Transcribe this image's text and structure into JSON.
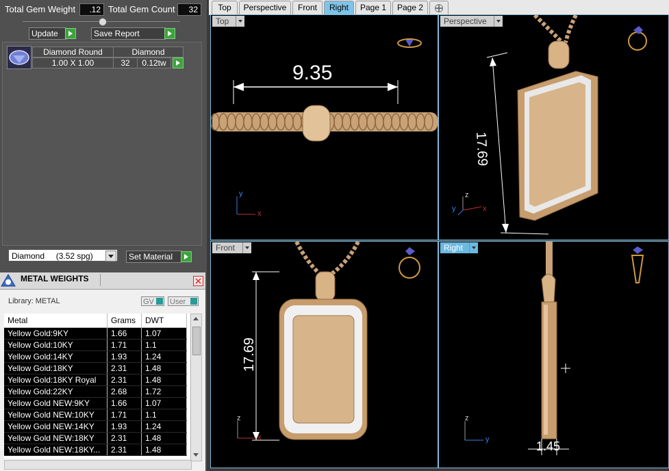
{
  "gem_summary": {
    "total_weight_label": "Total Gem Weight",
    "total_weight_value": ".12",
    "total_count_label": "Total Gem Count",
    "total_count_value": "32",
    "update_label": "Update",
    "save_report_label": "Save Report"
  },
  "gem_list": {
    "shape_header": "Diamond Round",
    "material_header": "Diamond",
    "size": "1.00 X 1.00",
    "count": "32",
    "weight": "0.12tw"
  },
  "material": {
    "selected": "Diamond     (3.52 spg)",
    "set_label": "Set Material"
  },
  "metal_weights": {
    "title": "METAL WEIGHTS",
    "library_label": "Library: METAL",
    "gv_label": "GV",
    "user_label": "User",
    "columns": [
      "Metal",
      "Grams",
      "DWT"
    ],
    "rows": [
      [
        "Yellow Gold:9KY",
        "1.66",
        "1.07"
      ],
      [
        "Yellow Gold:10KY",
        "1.71",
        "1.1"
      ],
      [
        "Yellow Gold:14KY",
        "1.93",
        "1.24"
      ],
      [
        "Yellow Gold:18KY",
        "2.31",
        "1.48"
      ],
      [
        "Yellow Gold:18KY Royal",
        "2.31",
        "1.48"
      ],
      [
        "Yellow Gold:22KY",
        "2.68",
        "1.72"
      ],
      [
        "Yellow Gold NEW:9KY",
        "1.66",
        "1.07"
      ],
      [
        "Yellow Gold NEW:10KY",
        "1.71",
        "1.1"
      ],
      [
        "Yellow Gold NEW:14KY",
        "1.93",
        "1.24"
      ],
      [
        "Yellow Gold NEW:18KY",
        "2.31",
        "1.48"
      ],
      [
        "Yellow Gold NEW:18KY...",
        "2.31",
        "1.48"
      ]
    ]
  },
  "tabs": [
    "Top",
    "Perspective",
    "Front",
    "Right",
    "Page 1",
    "Page 2"
  ],
  "active_tab": "Right",
  "viewports": {
    "top": {
      "label": "Top",
      "dimension": "9.35"
    },
    "perspective": {
      "label": "Perspective",
      "dimension": "17.69"
    },
    "front": {
      "label": "Front",
      "dimension": "17.69"
    },
    "right": {
      "label": "Right",
      "dimension": "1.45"
    }
  },
  "axes": {
    "x": "x",
    "y": "y",
    "z": "z"
  },
  "colors": {
    "accent": "#7ec3e8",
    "gold": "#d8b48a",
    "go_button": "#3da33d"
  }
}
